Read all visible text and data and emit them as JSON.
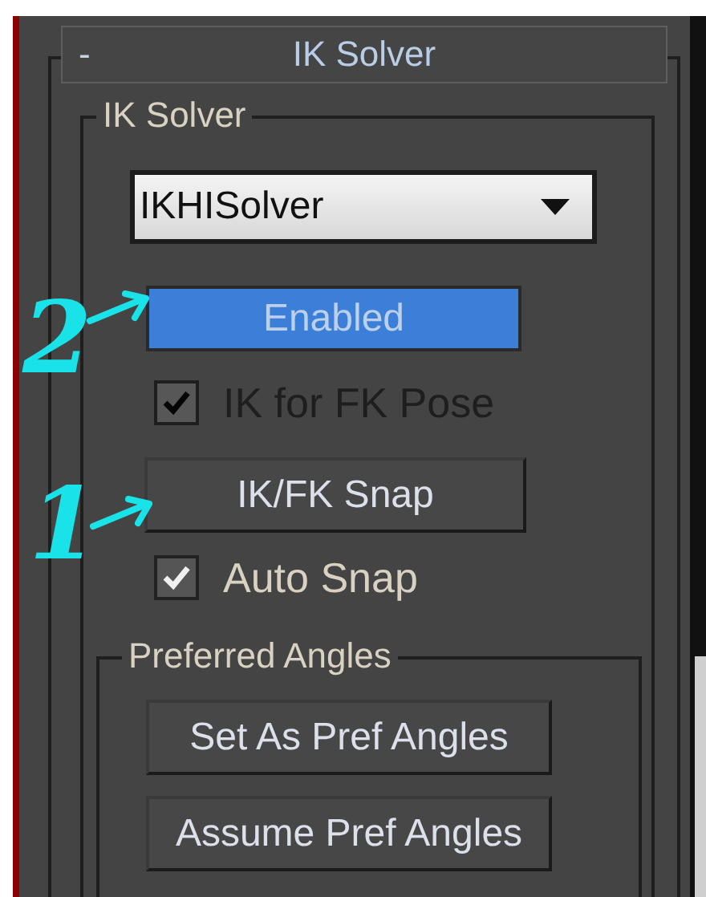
{
  "rollout": {
    "collapse_glyph": "-",
    "title": "IK Solver"
  },
  "ik_solver_group": {
    "label": "IK Solver",
    "solver_dropdown": {
      "value": "IKHISolver"
    },
    "enabled_button": {
      "label": "Enabled",
      "pressed": true
    },
    "ik_for_fk_pose": {
      "label": "IK for FK Pose",
      "checked": true,
      "disabled": true
    },
    "ik_fk_snap_button": {
      "label": "IK/FK Snap",
      "pressed": false
    },
    "auto_snap": {
      "label": "Auto Snap",
      "checked": true,
      "disabled": false
    }
  },
  "preferred_angles_group": {
    "label": "Preferred Angles",
    "buttons": [
      {
        "label": "Set As Pref Angles"
      },
      {
        "label": "Assume Pref Angles"
      }
    ]
  },
  "annotations": [
    {
      "label": "2"
    },
    {
      "label": "1"
    }
  ]
}
